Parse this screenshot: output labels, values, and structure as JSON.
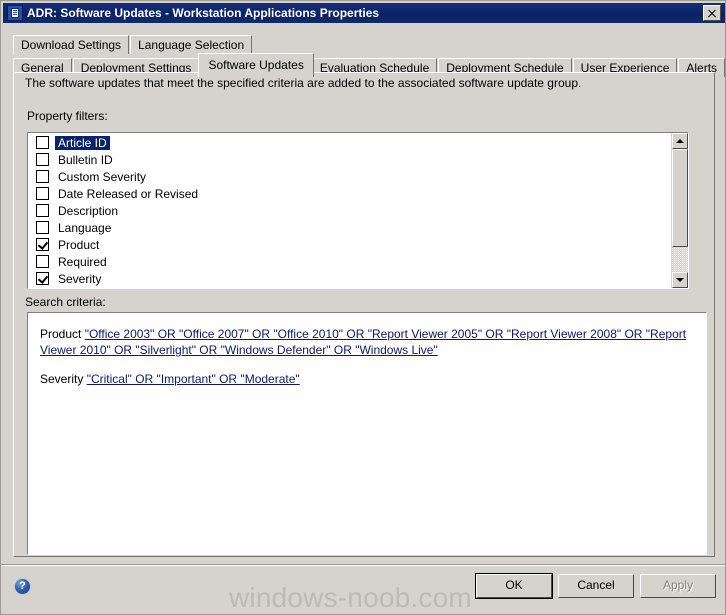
{
  "window": {
    "title": "ADR: Software Updates - Workstation Applications Properties",
    "icon": "properties-document-icon",
    "close_label": "✕"
  },
  "tabs": {
    "row1": [
      {
        "label": "Download Settings",
        "selected": false
      },
      {
        "label": "Language Selection",
        "selected": false
      }
    ],
    "row2": [
      {
        "label": "General",
        "selected": false
      },
      {
        "label": "Deployment Settings",
        "selected": false
      },
      {
        "label": "Software Updates",
        "selected": true
      },
      {
        "label": "Evaluation Schedule",
        "selected": false
      },
      {
        "label": "Deployment Schedule",
        "selected": false
      },
      {
        "label": "User Experience",
        "selected": false
      },
      {
        "label": "Alerts",
        "selected": false
      }
    ]
  },
  "main": {
    "description": "The software updates that meet the specified criteria are added to the associated software update group.",
    "property_filters_label": "Property filters:",
    "search_criteria_label": "Search criteria:",
    "filters": [
      {
        "label": "Article ID",
        "checked": false,
        "selected": true
      },
      {
        "label": "Bulletin ID",
        "checked": false,
        "selected": false
      },
      {
        "label": "Custom Severity",
        "checked": false,
        "selected": false
      },
      {
        "label": "Date Released or Revised",
        "checked": false,
        "selected": false
      },
      {
        "label": "Description",
        "checked": false,
        "selected": false
      },
      {
        "label": "Language",
        "checked": false,
        "selected": false
      },
      {
        "label": "Product",
        "checked": true,
        "selected": false
      },
      {
        "label": "Required",
        "checked": false,
        "selected": false
      },
      {
        "label": "Severity",
        "checked": true,
        "selected": false
      }
    ],
    "criteria": [
      {
        "key": "Product",
        "value": "\"Office 2003\" OR \"Office 2007\" OR \"Office 2010\" OR \"Report Viewer 2005\" OR \"Report Viewer 2008\" OR \"Report Viewer 2010\" OR \"Silverlight\" OR \"Windows Defender\" OR \"Windows Live\""
      },
      {
        "key": "Severity",
        "value": "\"Critical\" OR \"Important\" OR \"Moderate\""
      }
    ]
  },
  "footer": {
    "help_label": "?",
    "watermark": "windows-noob.com",
    "ok_label": "OK",
    "cancel_label": "Cancel",
    "apply_label": "Apply",
    "apply_enabled": false
  },
  "colors": {
    "titlebar": "#0a246a",
    "dialog_face": "#d6d3ce",
    "selection": "#0a246a",
    "link": "#0b1a6e",
    "watermark": "#bdbbb6"
  }
}
